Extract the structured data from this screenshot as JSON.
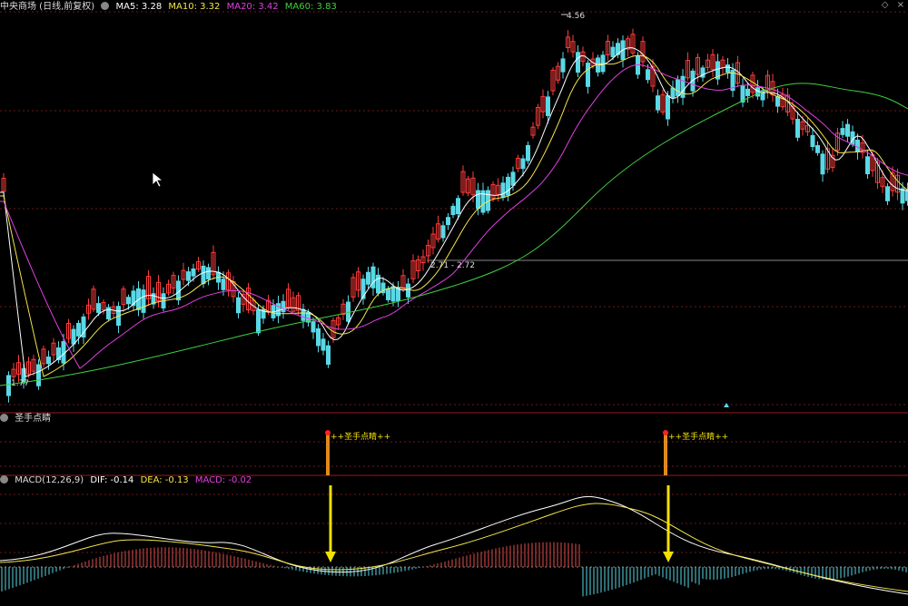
{
  "header": {
    "title": "中央商场 (日线,前复权)",
    "ma5": "MA5: 3.28",
    "ma10": "MA10: 3.32",
    "ma20": "MA20: 3.42",
    "ma60": "MA60: 3.83"
  },
  "annotations": {
    "high": "4.56",
    "range": "2.71 - 2.72",
    "low": "1.77"
  },
  "indicator_panel": {
    "title": "圣手点睛",
    "signal1": "++圣手点睛++",
    "signal2": "++圣手点睛++"
  },
  "macd_panel": {
    "title": "MACD(12,26,9)",
    "dif": "DIF: -0.14",
    "dea": "DEA: -0.13",
    "macd": "MACD: -0.02"
  },
  "colors": {
    "up": "#ff3b3b",
    "down": "#5ad8e6",
    "ma5": "#ffffff",
    "ma10": "#f5e64a",
    "ma20": "#e040e0",
    "ma60": "#40d040",
    "arrow": "#f5e000"
  },
  "icons": [
    "settings-icon",
    "diamond-icon",
    "close-icon"
  ]
}
